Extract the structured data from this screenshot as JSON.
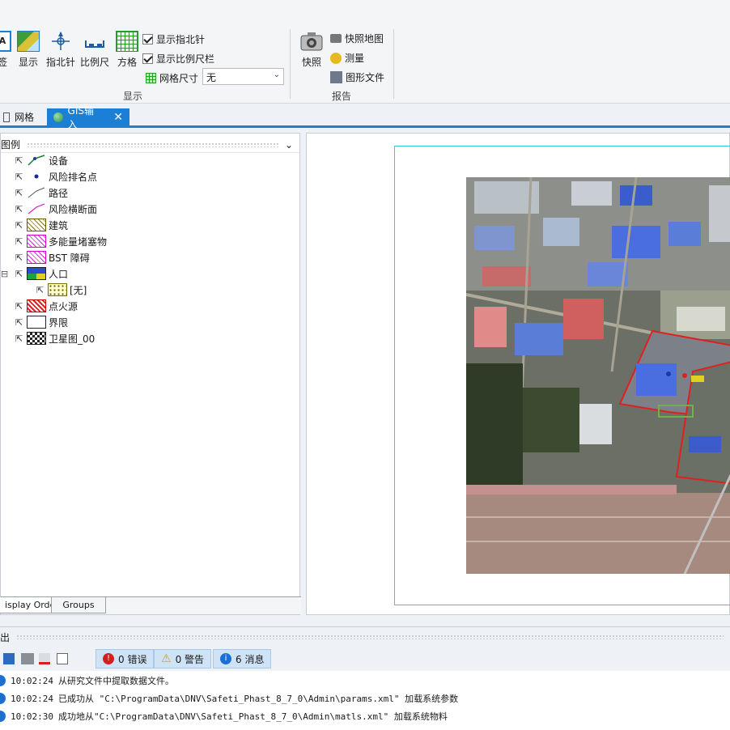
{
  "ribbon": {
    "buttons": [
      {
        "label": "签"
      },
      {
        "label": "显示"
      },
      {
        "label": "指北针"
      },
      {
        "label": "比例尺"
      },
      {
        "label": "方格"
      }
    ],
    "show_north": "显示指北针",
    "show_scale": "显示比例尺栏",
    "grid_size_label": "网格尺寸",
    "grid_size_value": "无",
    "group_display": "显示",
    "snapshot": "快照",
    "snapshot_map": "快照地图",
    "measure": "测量",
    "shape_file": "图形文件",
    "group_report": "报告"
  },
  "tabs": [
    {
      "label": "网格"
    },
    {
      "label": "GIS输入"
    }
  ],
  "legend": {
    "title": "图例",
    "items": [
      {
        "label": "设备"
      },
      {
        "label": "风险排名点"
      },
      {
        "label": "路径"
      },
      {
        "label": "风险横断面"
      },
      {
        "label": "建筑"
      },
      {
        "label": "多能量堵塞物"
      },
      {
        "label": "BST 障碍"
      },
      {
        "label": "人口"
      },
      {
        "label": "[无]"
      },
      {
        "label": "点火源"
      },
      {
        "label": "界限"
      },
      {
        "label": "卫星图_00"
      }
    ],
    "bottom_tabs": [
      "isplay Order",
      "Groups"
    ]
  },
  "output": {
    "title": "出",
    "errors": "0 错误",
    "warnings": "0 警告",
    "messages": "6 消息",
    "lines": [
      {
        "time": "10:02:24",
        "text": "从研究文件中提取数据文件。"
      },
      {
        "time": "10:02:24",
        "text": "已成功从 \"C:\\ProgramData\\DNV\\Safeti_Phast_8_7_0\\Admin\\params.xml\" 加载系统参数"
      },
      {
        "time": "10:02:30",
        "text": "成功地从\"C:\\ProgramData\\DNV\\Safeti_Phast_8_7_0\\Admin\\matls.xml\" 加载系统物料"
      }
    ]
  },
  "colors": {
    "accent": "#1c7fd6",
    "map_frame": "#36c9d8",
    "boundary": "#e02020"
  }
}
